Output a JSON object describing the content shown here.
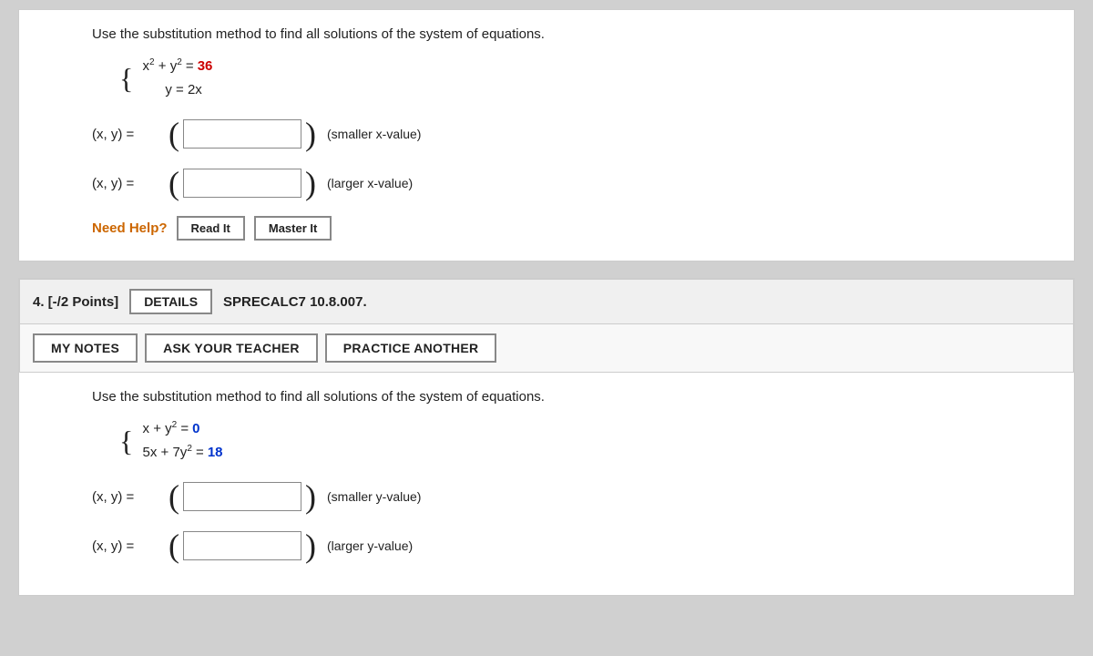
{
  "prev_problem": {
    "instruction": "Use the substitution method to find all solutions of the system of equations.",
    "eq1_part1": "x",
    "eq1_exp1": "2",
    "eq1_part2": " + y",
    "eq1_exp2": "2",
    "eq1_equals": " = ",
    "eq1_value": "36",
    "eq2": "y = 2x",
    "answer1_label": "(x, y) = ",
    "answer1_hint": "(smaller x-value)",
    "answer2_label": "(x, y) = ",
    "answer2_hint": "(larger x-value)",
    "need_help_label": "Need Help?",
    "btn_read": "Read It",
    "btn_master": "Master It"
  },
  "problem4": {
    "header": {
      "points_label": "4. [-/2 Points]",
      "details_label": "DETAILS",
      "code": "SPRECALC7 10.8.007."
    },
    "actions": {
      "my_notes": "MY NOTES",
      "ask_teacher": "ASK YOUR TEACHER",
      "practice_another": "PRACTICE ANOTHER"
    },
    "instruction": "Use the substitution method to find all solutions of the system of equations.",
    "eq1_part1": "x + y",
    "eq1_exp1": "2",
    "eq1_equals": " = ",
    "eq1_value": "0",
    "eq2_part1": "5x + 7y",
    "eq2_exp1": "2",
    "eq2_equals": " = ",
    "eq2_value": "18",
    "answer1_label": "(x, y) = ",
    "answer1_hint": "(smaller y-value)",
    "answer2_label": "(x, y) = ",
    "answer2_hint": "(larger y-value)"
  }
}
